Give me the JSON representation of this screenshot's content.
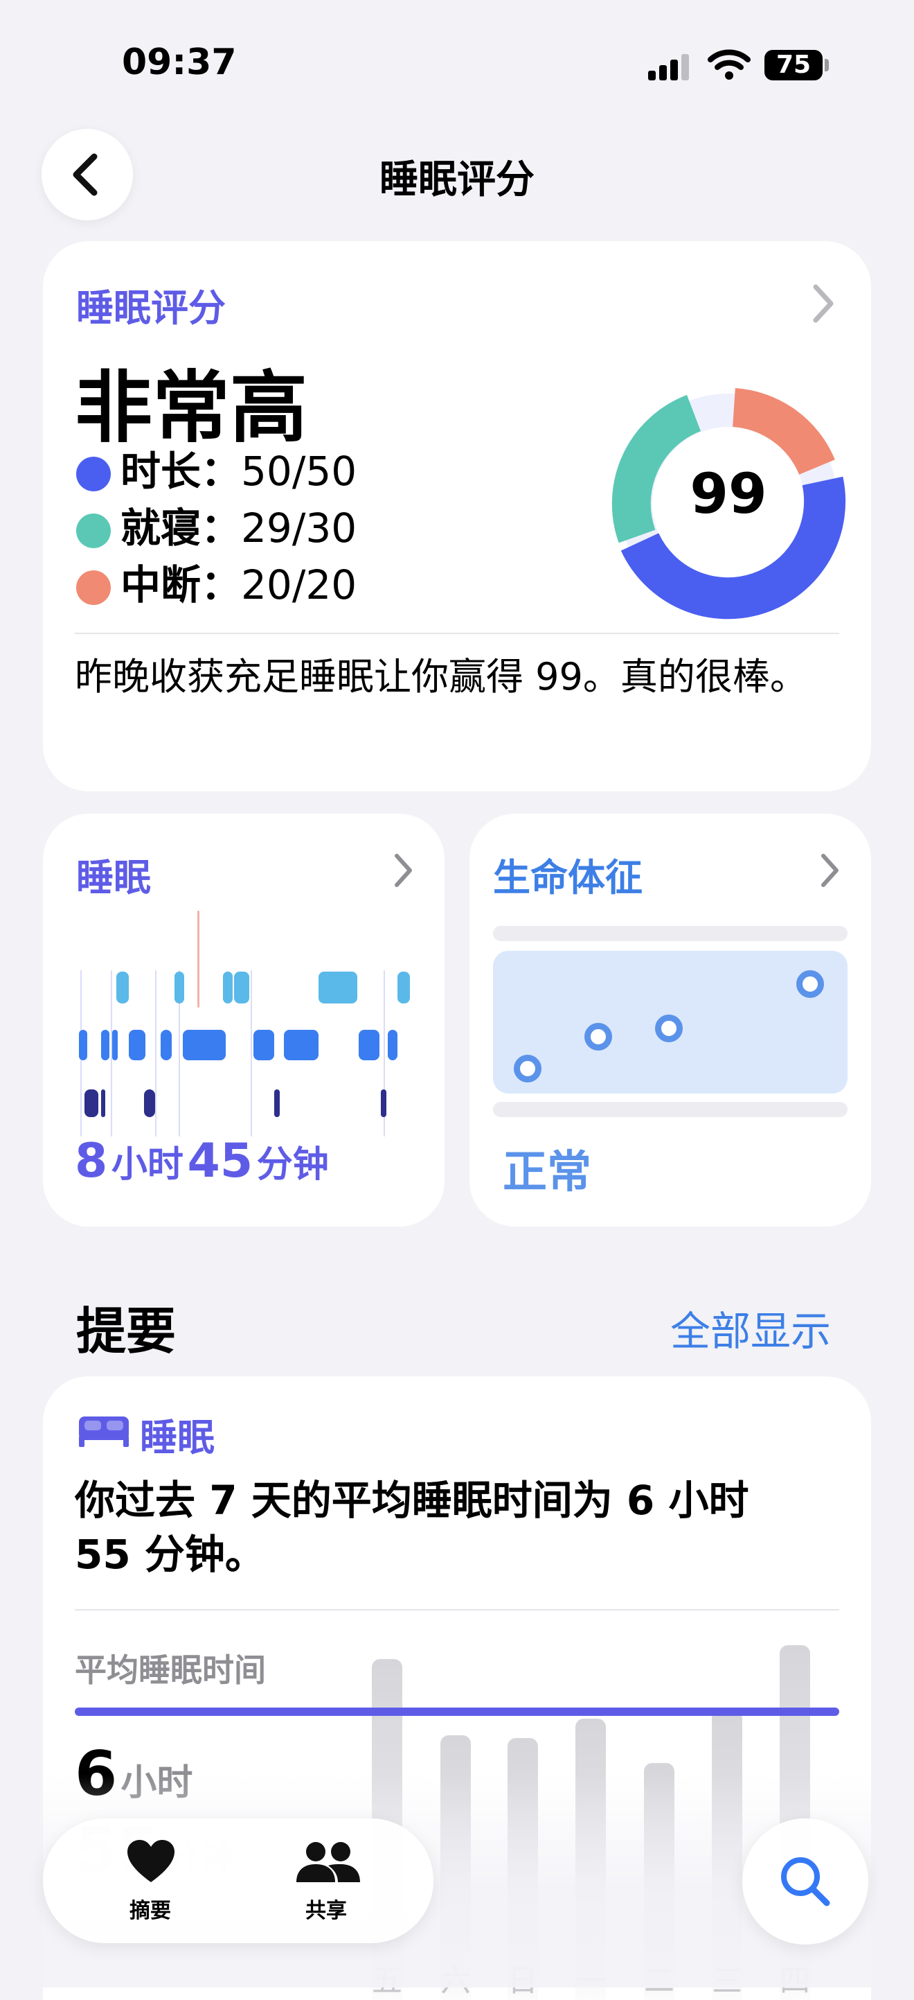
{
  "status_bar": {
    "time": "09:37",
    "battery": "75"
  },
  "header": {
    "title": "睡眠评分"
  },
  "score_card": {
    "label": "睡眠评分",
    "rating": "非常高",
    "score": "99",
    "breakdown": [
      {
        "name": "时长",
        "sep": "：",
        "value": "50/50",
        "color": "#4a5ff0"
      },
      {
        "name": "就寝",
        "sep": "：",
        "value": "29/30",
        "color": "#5ac8b5"
      },
      {
        "name": "中断",
        "sep": "：",
        "value": "20/20",
        "color": "#f08a72"
      }
    ],
    "description": "昨晚收获充足睡眠让你赢得 99。真的很棒。"
  },
  "sleep_card": {
    "label": "睡眠",
    "hours_value": "8",
    "hours_unit": "小时",
    "minutes_value": "45",
    "minutes_unit": "分钟"
  },
  "vitals_card": {
    "label": "生命体征",
    "status": "正常"
  },
  "highlights": {
    "title": "提要",
    "show_all": "全部显示",
    "card": {
      "category": "睡眠",
      "text": "你过去 7 天的平均睡眠时间为 6 小时 55 分钟。",
      "avg_label": "平均睡眠时间",
      "avg_hours": "6",
      "avg_hours_unit": "小时",
      "avg_minutes": "55",
      "avg_minutes_unit": "分钟",
      "days": [
        "五",
        "六",
        "日",
        "一",
        "二",
        "三",
        "四"
      ]
    }
  },
  "tab_bar": {
    "summary_label": "摘要",
    "sharing_label": "共享"
  },
  "colors": {
    "accent_purple": "#5e5ce6",
    "accent_blue": "#3478f6",
    "duration": "#4a5ff0",
    "bedtime": "#5ac8b5",
    "interruptions": "#f08a72"
  }
}
